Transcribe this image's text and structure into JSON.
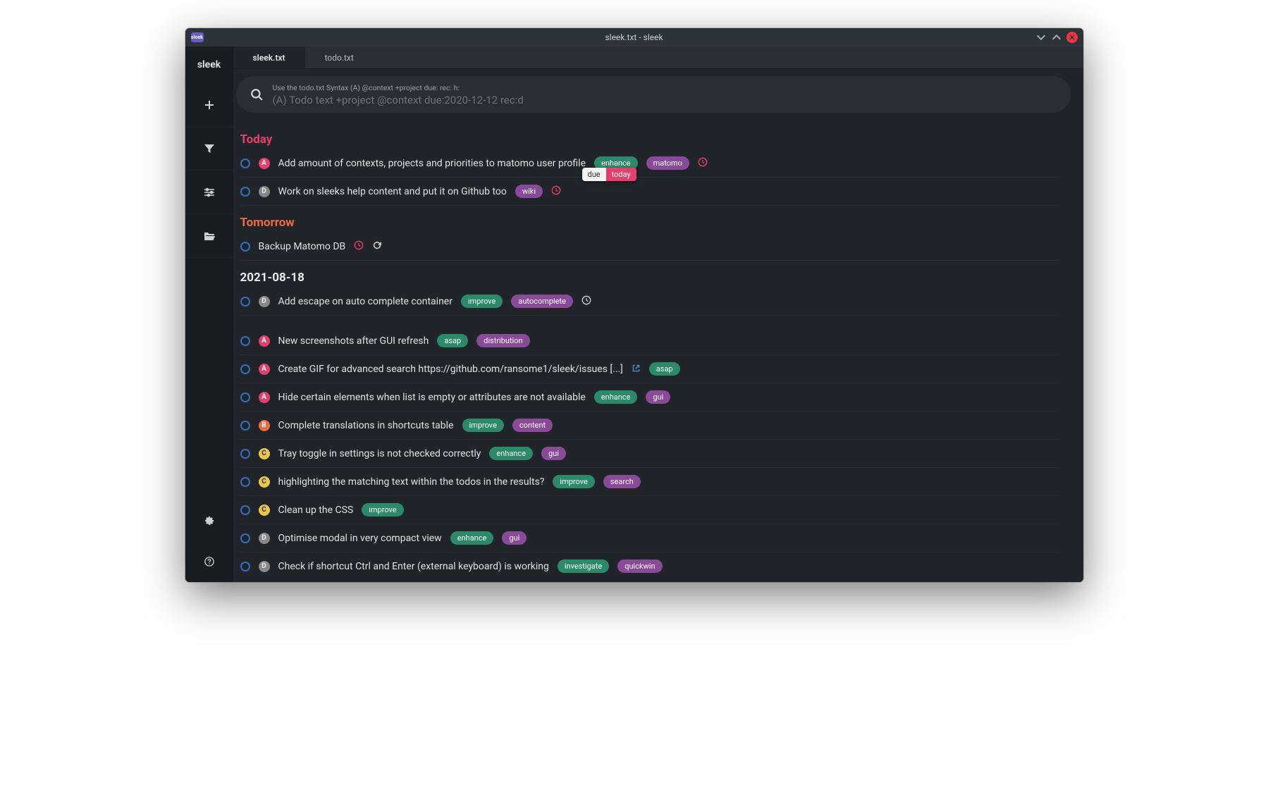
{
  "window": {
    "title": "sleek.txt - sleek",
    "app_icon_text": "sleek"
  },
  "logo": "sleek",
  "tabs": [
    {
      "label": "sleek.txt",
      "active": true
    },
    {
      "label": "todo.txt",
      "active": false
    }
  ],
  "search": {
    "hint": "Use the todo.txt Syntax (A) @context +project due: rec: h:",
    "placeholder": "(A) Todo text +project @context due:2020-12-12 rec:d"
  },
  "due_tooltip": {
    "label": "due",
    "value": "today"
  },
  "groups": [
    {
      "title": "Today",
      "class": "today",
      "todos": [
        {
          "priority": "A",
          "text": "Add amount of contexts, projects and priorities to matomo user profile",
          "tags": [
            {
              "text": "enhance",
              "color": "green"
            },
            {
              "text": "matomo",
              "color": "purple"
            }
          ],
          "icons": [
            "clock-red"
          ]
        },
        {
          "priority": "D",
          "text": "Work on sleeks help content and put it on Github too",
          "tags": [
            {
              "text": "wiki",
              "color": "purple"
            }
          ],
          "icons": [
            "clock-red"
          ],
          "show_due_tooltip": true
        }
      ]
    },
    {
      "title": "Tomorrow",
      "class": "tomorrow",
      "todos": [
        {
          "priority": "",
          "text": "Backup Matomo DB",
          "tags": [],
          "icons": [
            "clock-red",
            "recur"
          ]
        }
      ]
    },
    {
      "title": "2021-08-18",
      "class": "",
      "todos": [
        {
          "priority": "D",
          "text": "Add escape on auto complete container",
          "tags": [
            {
              "text": "improve",
              "color": "green"
            },
            {
              "text": "autocomplete",
              "color": "purple"
            }
          ],
          "icons": [
            "clock"
          ]
        }
      ]
    },
    {
      "title": "",
      "class": "",
      "todos": [
        {
          "priority": "A",
          "text": "New screenshots after GUI refresh",
          "tags": [
            {
              "text": "asap",
              "color": "green"
            },
            {
              "text": "distribution",
              "color": "purple"
            }
          ],
          "icons": []
        },
        {
          "priority": "A",
          "text": "Create GIF for advanced search https://github.com/ransome1/sleek/issues [...]",
          "extlink": true,
          "tags": [
            {
              "text": "asap",
              "color": "green"
            }
          ],
          "icons": []
        },
        {
          "priority": "A",
          "text": "Hide certain elements when list is empty or attributes are not available",
          "tags": [
            {
              "text": "enhance",
              "color": "green"
            },
            {
              "text": "gui",
              "color": "purple"
            }
          ],
          "icons": []
        },
        {
          "priority": "B",
          "text": "Complete translations in shortcuts table",
          "tags": [
            {
              "text": "improve",
              "color": "green"
            },
            {
              "text": "content",
              "color": "purple"
            }
          ],
          "icons": []
        },
        {
          "priority": "C",
          "text": "Tray toggle in settings is not checked correctly",
          "tags": [
            {
              "text": "enhance",
              "color": "green"
            },
            {
              "text": "gui",
              "color": "purple"
            }
          ],
          "icons": []
        },
        {
          "priority": "C",
          "text": "highlighting the matching text within the todos in the results?",
          "tags": [
            {
              "text": "improve",
              "color": "green"
            },
            {
              "text": "search",
              "color": "purple"
            }
          ],
          "icons": []
        },
        {
          "priority": "C",
          "text": "Clean up the CSS",
          "tags": [
            {
              "text": "improve",
              "color": "green"
            }
          ],
          "icons": []
        },
        {
          "priority": "D",
          "text": "Optimise modal in very compact view",
          "tags": [
            {
              "text": "enhance",
              "color": "green"
            },
            {
              "text": "gui",
              "color": "purple"
            }
          ],
          "icons": []
        },
        {
          "priority": "D",
          "text": "Check if shortcut Ctrl and Enter (external keyboard) is working",
          "tags": [
            {
              "text": "investigate",
              "color": "green"
            },
            {
              "text": "quickwin",
              "color": "purple"
            }
          ],
          "icons": []
        }
      ]
    }
  ]
}
